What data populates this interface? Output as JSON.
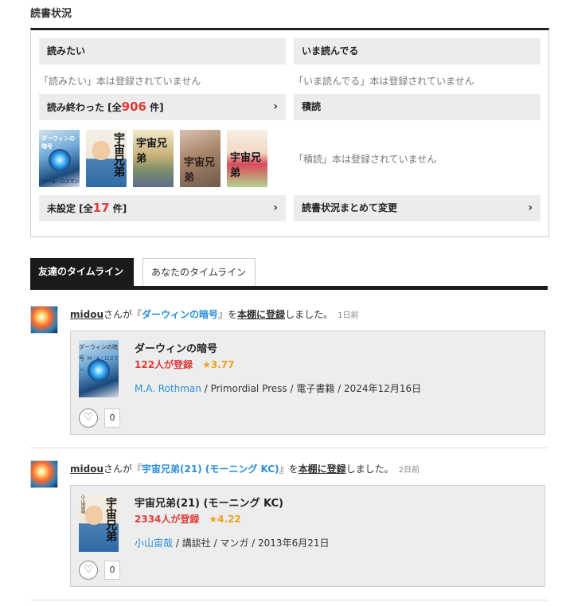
{
  "section_title": "読書状況",
  "status": {
    "want": {
      "label": "読みたい",
      "empty": "「読みたい」本は登録されていません"
    },
    "reading": {
      "label": "いま読んでる",
      "empty": "「いま読んでる」本は登録されていません"
    },
    "read": {
      "label_prefix": "読み終わった [全",
      "count": "906",
      "label_suffix": " 件]"
    },
    "stacked": {
      "label": "積読",
      "empty": "「積読」本は登録されていません"
    },
    "unset": {
      "label_prefix": "未設定 [全",
      "count": "17",
      "label_suffix": " 件]"
    },
    "bulk": {
      "label": "読書状況まとめて変更"
    },
    "covers": [
      {
        "title": "ダーウィンの暗号",
        "subtitle": "M・A・ロスマン"
      },
      {
        "title": "宇宙兄弟"
      },
      {
        "title": "宇宙兄弟"
      },
      {
        "title": "宇宙兄弟"
      },
      {
        "title": "宇宙兄弟"
      }
    ]
  },
  "tabs": {
    "friends": "友達のタイムライン",
    "yours": "あなたのタイムライン"
  },
  "timeline": [
    {
      "user": "midou",
      "text1": "さんが『",
      "book": "ダーウィンの暗号",
      "text2": "』を",
      "shelf": "本棚に登録",
      "text3": "しました。",
      "ago": "1日前",
      "card": {
        "title": "ダーウィンの暗号",
        "registered": "122人が登録",
        "rating": "★3.77",
        "author": "M.A. Rothman",
        "meta": " / Primordial Press / 電子書籍 / 2024年12月16日",
        "cover_title": "ダーウィンの暗号",
        "cover_sub": "M・A・ロスマン",
        "likes": "0"
      }
    },
    {
      "user": "midou",
      "text1": "さんが『",
      "book": "宇宙兄弟(21) (モーニング KC)",
      "text2": "』を",
      "shelf": "本棚に登録",
      "text3": "しました。",
      "ago": "2日前",
      "card": {
        "title": "宇宙兄弟(21) (モーニング KC)",
        "registered": "2334人が登録",
        "rating": "★4.22",
        "author": "小山宙哉",
        "meta": " / 講談社 / マンガ / 2013年6月21日",
        "cover_title": "宇宙兄弟",
        "cover_sub": "小山宙哉",
        "likes": "0"
      }
    }
  ]
}
